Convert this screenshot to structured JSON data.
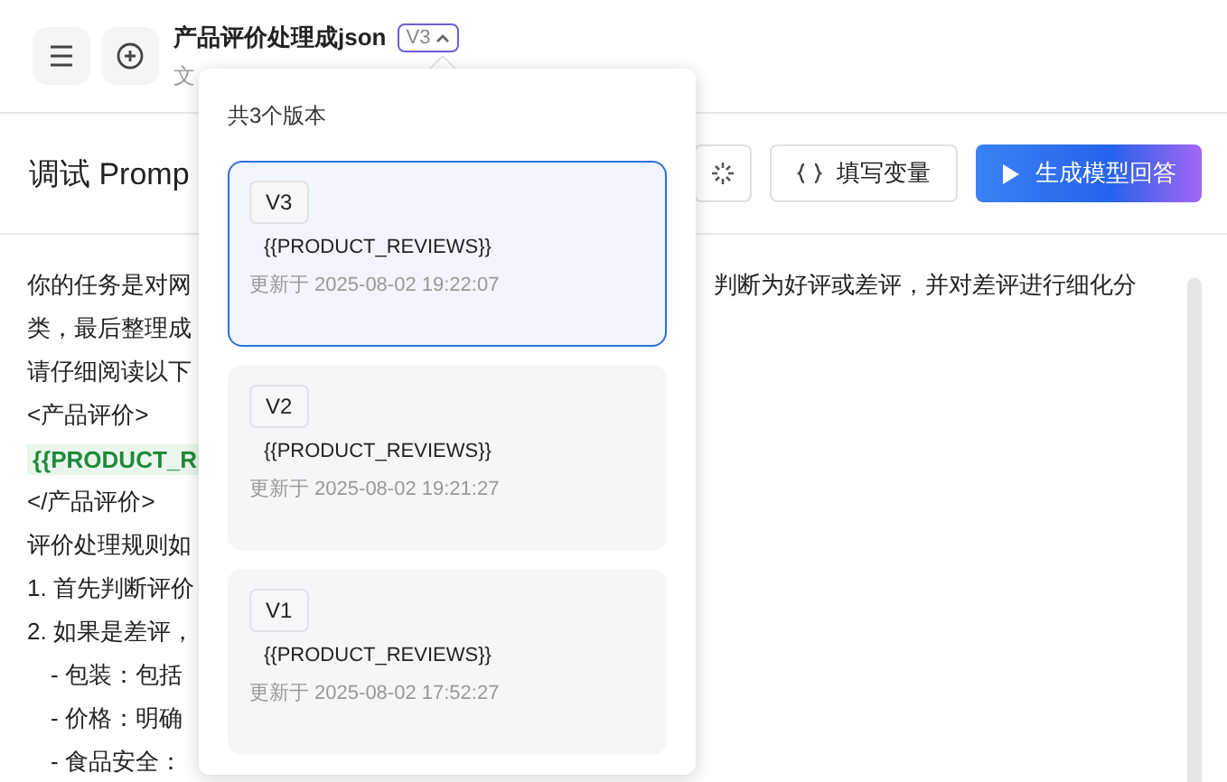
{
  "header": {
    "title": "产品评价处理成json",
    "version": "V3",
    "version_expanded": true,
    "subtitle": "文"
  },
  "toolbar": {
    "title": "调试 Promp",
    "buttons": [
      {
        "kind": "icon"
      },
      {
        "kind": "variables",
        "label": "填写变量"
      },
      {
        "kind": "primary",
        "label": "生成模型回答"
      }
    ]
  },
  "prompt_lines": [
    {
      "text": "你的任务是对网",
      "tail": "判断为好评或差评，并对差评进行细化分"
    },
    {
      "text": "类，最后整理成"
    },
    {
      "text": "请仔细阅读以下"
    },
    {
      "text": "<产品评价>"
    },
    {
      "text": "{{PRODUCT_R",
      "kind": "variable"
    },
    {
      "text": "</产品评价>"
    },
    {
      "text": "评价处理规则如"
    },
    {
      "text": "1. 首先判断评价"
    },
    {
      "text": "2. 如果是差评，"
    },
    {
      "text": "- 包装：包括",
      "kind": "indent"
    },
    {
      "text": "- 价格：明确",
      "kind": "indent"
    },
    {
      "text": "- 食品安全：",
      "kind": "indent"
    }
  ],
  "versions_popover": {
    "heading": "共3个版本",
    "versions": [
      {
        "label": "V3",
        "content": "{{PRODUCT_REVIEWS}}",
        "updated": "更新于 2025-08-02 19:22:07",
        "selected": true
      },
      {
        "label": "V2",
        "content": "{{PRODUCT_REVIEWS}}",
        "updated": "更新于 2025-08-02 19:21:27",
        "selected": false
      },
      {
        "label": "V1",
        "content": "{{PRODUCT_REVIEWS}}",
        "updated": "更新于 2025-08-02 17:52:27",
        "selected": false
      }
    ]
  }
}
